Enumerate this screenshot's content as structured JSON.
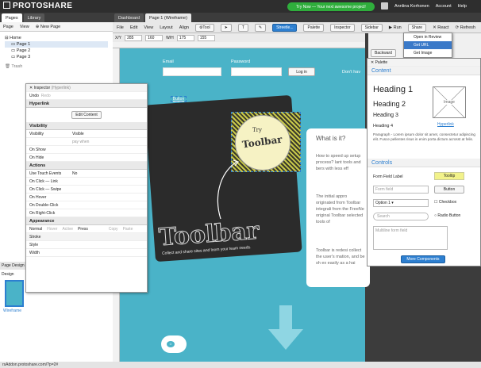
{
  "app": {
    "logo": "PROTOSHARE",
    "promo": "Try Now — Your next awesome project!",
    "user": "Annlina Korhonen",
    "account": "Account",
    "help": "Help"
  },
  "left": {
    "tabs": [
      "Pages",
      "Library"
    ],
    "toolbar": [
      "Page",
      "View",
      "New Page"
    ],
    "tree": [
      "Home",
      "Page 1",
      "Page 2",
      "Page 3",
      "Trash"
    ],
    "page_design_label": "Page Design",
    "design_label": "Design",
    "wireframe_label": "Wireframe"
  },
  "main": {
    "tabs": [
      "Dashboard",
      "Page 1 (Wireframe)"
    ],
    "menu": [
      "File",
      "Edit",
      "View",
      "Layout",
      "Align"
    ],
    "buttons": [
      "Tool",
      "Streetle...",
      "Palette",
      "Inspector",
      "Sidebar",
      "Run",
      "Share",
      "React",
      "Refresh"
    ],
    "coords": {
      "x_label": "X/Y",
      "x": "285",
      "y": "160",
      "w_label": "W/H",
      "w": "175",
      "h": "155"
    }
  },
  "canvas": {
    "email_label": "Email",
    "password_label": "Password",
    "login_btn": "Log in",
    "no_account": "Don't hav",
    "button_link": "Button",
    "try": "Try",
    "toolbar_badge": "Toolbar",
    "big_toolbar": "Toolbar",
    "tagline": "Collect and share sites and loom your team needs.",
    "card_title": "What is it?",
    "card_p1": "How to speed up setup process? lant tools and bers with less eff",
    "card_p2": "The initial appro originated from Toolbar integrali from the FreeNe original Toolbar selected tools of",
    "card_p3": "Toolbar is redesi collect the user's mation, and be sh ex easily as a hai"
  },
  "inspector": {
    "title": "Inspector",
    "subtitle": "(Hyperlink)",
    "undo": "Undo",
    "redo": "Redo",
    "sections": [
      "Hyperlink",
      "Visibility",
      "Actions",
      "Appearance"
    ],
    "edit_content": "Edit Content",
    "vis_rows": [
      [
        "Visibility",
        "Visible"
      ],
      [
        "",
        "pay when"
      ],
      [
        "On Show",
        ""
      ],
      [
        "On Hide",
        ""
      ]
    ],
    "act_rows": [
      [
        "Use Touch Events",
        "No"
      ],
      [
        "On Click — Link",
        ""
      ],
      [
        "On Click — Swipe",
        ""
      ],
      [
        "On Hover",
        ""
      ],
      [
        "On Double-Click",
        ""
      ],
      [
        "On Right-Click",
        ""
      ]
    ],
    "app_tabs": [
      "Normal",
      "Hover",
      "Active",
      "Press",
      "Copy",
      "Paste"
    ],
    "app_rows": [
      "Stroke",
      "Style",
      "Width"
    ]
  },
  "dropdown": {
    "items": [
      "Open in Review",
      "Get URL",
      "Get Image"
    ],
    "selected": 1
  },
  "palette": {
    "title": "Palette",
    "content_title": "Content",
    "h1": "Heading 1",
    "h2": "Heading 2",
    "h3": "Heading 3",
    "h4": "Heading 4",
    "image": "Image",
    "hyperlink": "Hyperlink",
    "paragraph": "Paragraph - Lorem ipsum dolor sit amet, consectetur adipiscing elit. Fusce pellentes risus in enim porta dictum acrosst at felis.",
    "controls_title": "Controls",
    "form_label": "Form Field Label",
    "tooltip": "Tooltip",
    "form_field": "Form field",
    "button": "Button",
    "option": "Option 1",
    "checkbox": "Checkbox",
    "search": "Search",
    "radio": "Radio Button",
    "multiline": "Multiline form field",
    "more": "More Components"
  },
  "right": {
    "backward": "Backward"
  },
  "status": "rsAddon.protoshare.com/?p=2#",
  "colors": {
    "accent": "#2d7fd0",
    "canvas": "#4ab3c8",
    "promo": "#2fae3c",
    "card": "#2b2b2b"
  }
}
